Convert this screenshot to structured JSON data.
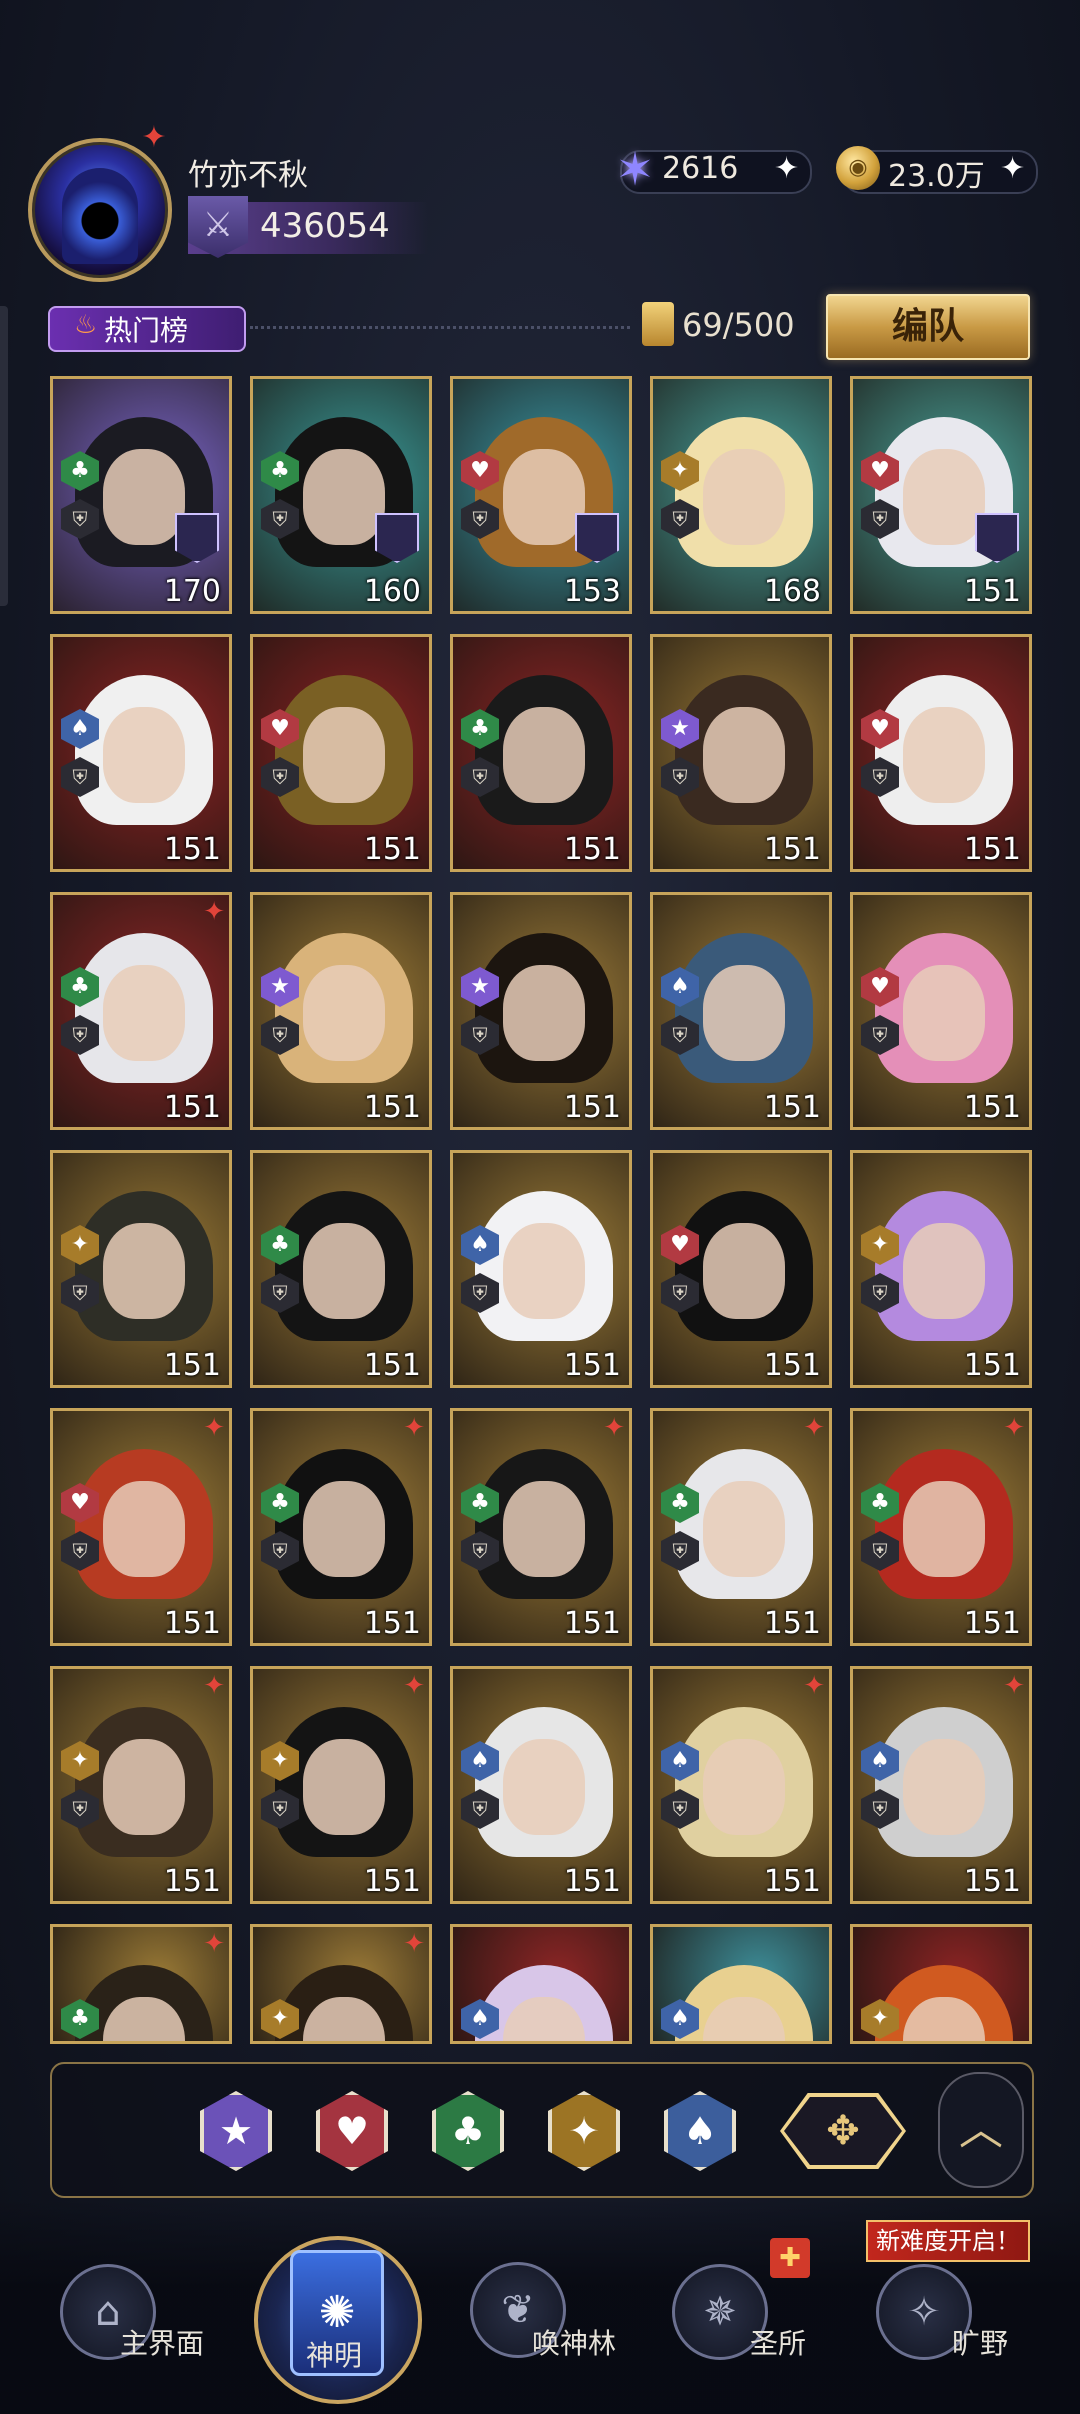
{
  "player": {
    "name": "竹亦不秋",
    "power": "436054"
  },
  "resources": [
    {
      "name": "star-currency",
      "value": "2616"
    },
    {
      "name": "gold",
      "value": "23.0万"
    }
  ],
  "toolbar": {
    "hot_list_label": "热门榜",
    "capacity": "69/500",
    "team_button": "编队"
  },
  "suits": {
    "star": "★",
    "heart": "♥",
    "club": "♣",
    "diamond": "✦",
    "spade": "♠"
  },
  "suit_colors": {
    "star": "#7e5ad0",
    "heart": "#b23a42",
    "club": "#2f8a48",
    "diamond": "#a77c2a",
    "spade": "#3f64a8"
  },
  "cards": [
    {
      "suit": "club",
      "level": "170",
      "bg": "#7a66c9",
      "hair": "#1b1b22",
      "rank": true
    },
    {
      "suit": "club",
      "level": "160",
      "bg": "#3a9c9a",
      "hair": "#141414",
      "rank": true
    },
    {
      "suit": "heart",
      "level": "153",
      "bg": "#3a9aa8",
      "hair": "#a06a2a",
      "rank": true
    },
    {
      "suit": "diamond",
      "level": "168",
      "bg": "#49a6a0",
      "hair": "#f0dfaa",
      "rank": false
    },
    {
      "suit": "heart",
      "level": "151",
      "bg": "#4aa39a",
      "hair": "#e8e8ee",
      "rank": true
    },
    {
      "suit": "spade",
      "level": "151",
      "bg": "#8f2424",
      "hair": "#f0f0f0",
      "rank": false
    },
    {
      "suit": "heart",
      "level": "151",
      "bg": "#8a2222",
      "hair": "#7a6024",
      "rank": false
    },
    {
      "suit": "club",
      "level": "151",
      "bg": "#8d2525",
      "hair": "#1a1a1a",
      "rank": false
    },
    {
      "suit": "star",
      "level": "151",
      "bg": "#9b7a36",
      "hair": "#3a2a20",
      "rank": false
    },
    {
      "suit": "heart",
      "level": "151",
      "bg": "#8e2424",
      "hair": "#eeeeee",
      "rank": false
    },
    {
      "suit": "club",
      "level": "151",
      "bg": "#8d2626",
      "hair": "#e6e6ea",
      "rank": false,
      "corner": true
    },
    {
      "suit": "star",
      "level": "151",
      "bg": "#9b7a36",
      "hair": "#d9b37a",
      "rank": false
    },
    {
      "suit": "star",
      "level": "151",
      "bg": "#9a7a38",
      "hair": "#1c150f",
      "rank": false
    },
    {
      "suit": "spade",
      "level": "151",
      "bg": "#9c7b38",
      "hair": "#3a5a7a",
      "rank": false
    },
    {
      "suit": "heart",
      "level": "151",
      "bg": "#9b7a36",
      "hair": "#e48fb8",
      "rank": false
    },
    {
      "suit": "diamond",
      "level": "151",
      "bg": "#9a7a36",
      "hair": "#2e2e26",
      "rank": false
    },
    {
      "suit": "club",
      "level": "151",
      "bg": "#9b7a37",
      "hair": "#141414",
      "rank": false
    },
    {
      "suit": "spade",
      "level": "151",
      "bg": "#9c7c38",
      "hair": "#f2f2f4",
      "rank": false
    },
    {
      "suit": "heart",
      "level": "151",
      "bg": "#9a7935",
      "hair": "#111111",
      "rank": false
    },
    {
      "suit": "diamond",
      "level": "151",
      "bg": "#9b7a36",
      "hair": "#b48adf",
      "rank": false
    },
    {
      "suit": "heart",
      "level": "151",
      "bg": "#9a7a36",
      "hair": "#b73b22",
      "rank": false,
      "corner": true
    },
    {
      "suit": "club",
      "level": "151",
      "bg": "#9b7a37",
      "hair": "#111111",
      "rank": false,
      "corner": true
    },
    {
      "suit": "club",
      "level": "151",
      "bg": "#9a7935",
      "hair": "#171717",
      "rank": false,
      "corner": true
    },
    {
      "suit": "club",
      "level": "151",
      "bg": "#9b7a36",
      "hair": "#e7e7ea",
      "rank": false,
      "corner": true
    },
    {
      "suit": "club",
      "level": "151",
      "bg": "#9b7a36",
      "hair": "#b42a1f",
      "rank": false,
      "corner": true
    },
    {
      "suit": "diamond",
      "level": "151",
      "bg": "#9a7a36",
      "hair": "#3a2d20",
      "rank": false,
      "corner": true
    },
    {
      "suit": "diamond",
      "level": "151",
      "bg": "#9b7a37",
      "hair": "#141414",
      "rank": false,
      "corner": true
    },
    {
      "suit": "spade",
      "level": "151",
      "bg": "#9a7935",
      "hair": "#e6e6e6",
      "rank": false
    },
    {
      "suit": "spade",
      "level": "151",
      "bg": "#9b7a36",
      "hair": "#e0d0a0",
      "rank": false,
      "corner": true
    },
    {
      "suit": "spade",
      "level": "151",
      "bg": "#9b7a36",
      "hair": "#cfcfcf",
      "rank": false,
      "corner": true
    },
    {
      "suit": "club",
      "level": "",
      "bg": "#9a7a36",
      "hair": "#2a2218",
      "rank": false,
      "corner": true,
      "partial": true
    },
    {
      "suit": "diamond",
      "level": "",
      "bg": "#9b7a37",
      "hair": "#2a1f14",
      "rank": false,
      "corner": true,
      "partial": true
    },
    {
      "suit": "spade",
      "level": "",
      "bg": "#8f2626",
      "hair": "#d8c6e8",
      "rank": false,
      "partial": true
    },
    {
      "suit": "spade",
      "level": "",
      "bg": "#3e8f9a",
      "hair": "#e8d090",
      "rank": false,
      "partial": true
    },
    {
      "suit": "diamond",
      "level": "",
      "bg": "#8e2424",
      "hair": "#d05a20",
      "rank": false,
      "partial": true
    }
  ],
  "filters": [
    {
      "name": "star",
      "glyph": "★",
      "color": "#6b52b8"
    },
    {
      "name": "heart",
      "glyph": "♥",
      "color": "#a43440"
    },
    {
      "name": "club",
      "glyph": "♣",
      "color": "#2c7a44"
    },
    {
      "name": "diamond",
      "glyph": "✦",
      "color": "#9c7424"
    },
    {
      "name": "spade",
      "glyph": "♠",
      "color": "#3c5e9c"
    }
  ],
  "nav": {
    "items": [
      {
        "label": "主界面",
        "icon": "home-icon"
      },
      {
        "label": "神明",
        "icon": "deity-card-icon",
        "active": true
      },
      {
        "label": "唤神林",
        "icon": "tree-icon"
      },
      {
        "label": "圣所",
        "icon": "sanctuary-icon"
      },
      {
        "label": "旷野",
        "icon": "compass-icon"
      }
    ],
    "new_difficulty_tag": "新难度开启！"
  }
}
